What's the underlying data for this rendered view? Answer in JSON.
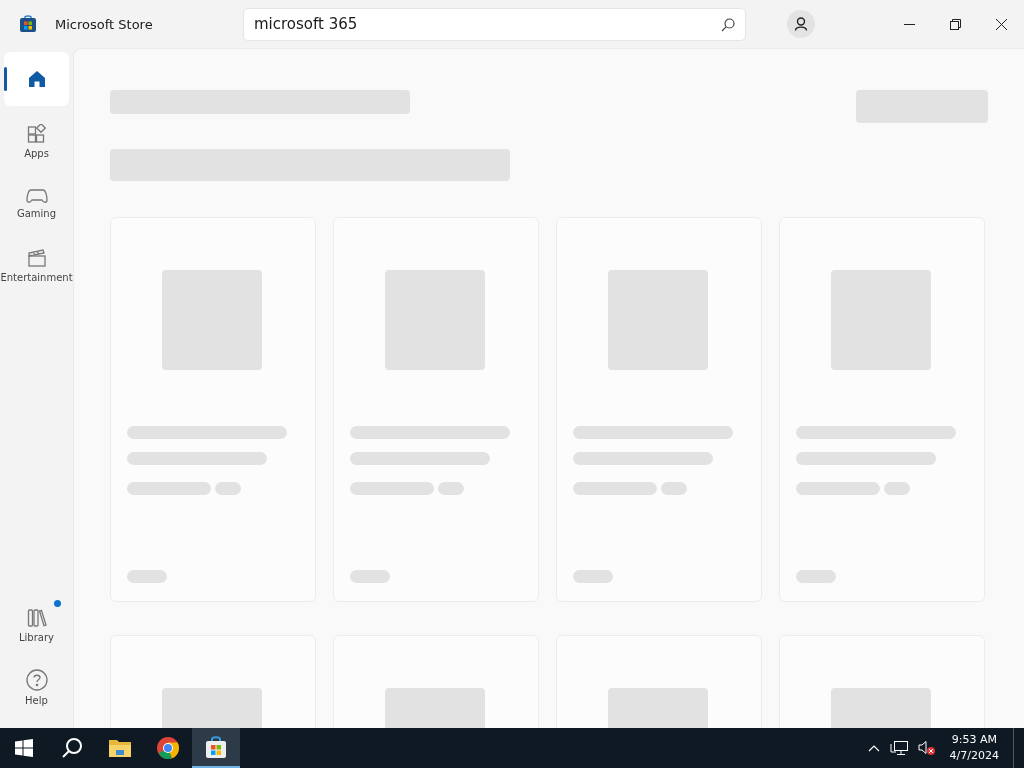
{
  "window": {
    "title": "Microsoft Store"
  },
  "search": {
    "value": "microsoft 365"
  },
  "nav": {
    "items": [
      {
        "kind": "home",
        "selected": true,
        "badge": false
      },
      {
        "kind": "apps",
        "label": "Apps",
        "selected": false,
        "badge": false
      },
      {
        "kind": "gaming",
        "label": "Gaming",
        "selected": false,
        "badge": false
      },
      {
        "kind": "entertainment",
        "label": "Entertainment",
        "selected": false,
        "badge": false
      }
    ],
    "bottom_items": [
      {
        "kind": "library",
        "label": "Library",
        "selected": false,
        "badge": true
      },
      {
        "kind": "help",
        "label": "Help",
        "selected": false,
        "badge": false
      }
    ]
  },
  "taskbar": {
    "apps": [
      {
        "kind": "start",
        "selected": false
      },
      {
        "kind": "search",
        "selected": false
      },
      {
        "kind": "explorer",
        "selected": false
      },
      {
        "kind": "chrome",
        "selected": false
      },
      {
        "kind": "store",
        "selected": true
      }
    ],
    "time": "9:53 AM",
    "date": "4/7/2024"
  }
}
